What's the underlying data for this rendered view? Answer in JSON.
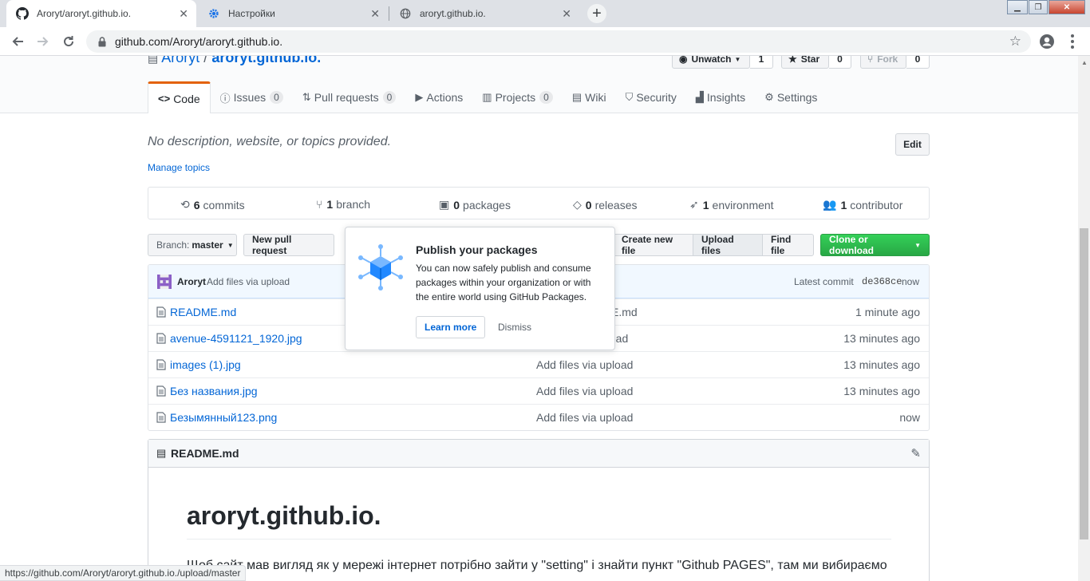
{
  "browser": {
    "tabs": [
      {
        "title": "Aroryt/aroryt.github.io."
      },
      {
        "title": "Настройки"
      },
      {
        "title": "aroryt.github.io."
      }
    ],
    "url": "github.com/Aroryt/aroryt.github.io.",
    "status_url": "https://github.com/Aroryt/aroryt.github.io./upload/master"
  },
  "repo": {
    "owner": "Aroryt",
    "separator": "/",
    "name": "aroryt.github.io.",
    "unwatch_label": "Unwatch",
    "watch_count": "1",
    "star_label": "Star",
    "star_count": "0",
    "fork_label": "Fork",
    "fork_count": "0"
  },
  "nav": {
    "code": "Code",
    "issues": "Issues",
    "issues_count": "0",
    "pulls": "Pull requests",
    "pulls_count": "0",
    "actions": "Actions",
    "projects": "Projects",
    "projects_count": "0",
    "wiki": "Wiki",
    "security": "Security",
    "insights": "Insights",
    "settings": "Settings"
  },
  "description": "No description, website, or topics provided.",
  "edit_label": "Edit",
  "manage_topics": "Manage topics",
  "summary": {
    "commits_num": "6",
    "commits_label": "commits",
    "branch_num": "1",
    "branch_label": "branch",
    "packages_num": "0",
    "packages_label": "packages",
    "releases_num": "0",
    "releases_label": "releases",
    "env_num": "1",
    "env_label": "environment",
    "contrib_num": "1",
    "contrib_label": "contributor"
  },
  "toolbar": {
    "branch_prefix": "Branch:",
    "branch_name": "master",
    "new_pr": "New pull request",
    "create_file": "Create new file",
    "upload_files": "Upload files",
    "find_file": "Find file",
    "clone": "Clone or download"
  },
  "commit": {
    "author": "Aroryt",
    "message": "Add files via upload",
    "latest_label": "Latest commit",
    "sha": "de368ce",
    "age": "now"
  },
  "files": [
    {
      "name": "README.md",
      "message": "E.md",
      "age": "1 minute ago"
    },
    {
      "name": "avenue-4591121_1920.jpg",
      "message": "pload",
      "age": "13 minutes ago"
    },
    {
      "name": "images (1).jpg",
      "message": "Add files via upload",
      "age": "13 minutes ago"
    },
    {
      "name": "Без названия.jpg",
      "message": "Add files via upload",
      "age": "13 minutes ago"
    },
    {
      "name": "Безымянный123.png",
      "message": "Add files via upload",
      "age": "now"
    }
  ],
  "readme": {
    "filename": "README.md",
    "heading": "aroryt.github.io.",
    "paragraph": "Щоб сайт мав вигляд як у мережі інтернет потрібно зайти у \"setting\" і знайти пункт \"Github PAGES\", там ми вибираємо"
  },
  "popover": {
    "title": "Publish your packages",
    "body": "You can now safely publish and consume packages within your organization or with the entire world using GitHub Packages.",
    "learn_more": "Learn more",
    "dismiss": "Dismiss"
  }
}
